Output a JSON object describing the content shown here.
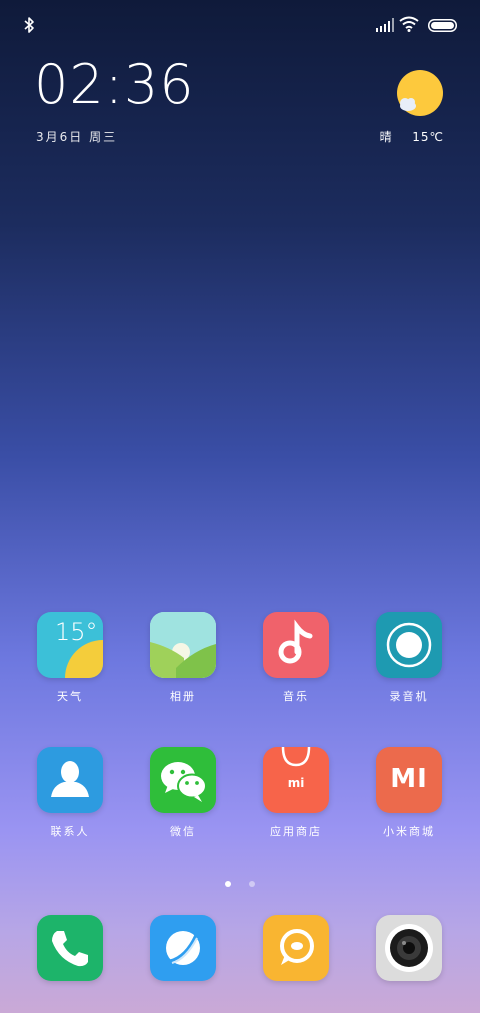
{
  "status_bar": {
    "icons": [
      "bluetooth-icon",
      "signal-icon",
      "wifi-icon",
      "battery-icon"
    ]
  },
  "clock": {
    "time": "02:36",
    "date": "3月6日 周三"
  },
  "weather": {
    "condition": "晴",
    "temperature": "15℃",
    "icon": "sun-icon"
  },
  "apps": [
    {
      "label": "天气",
      "icon_text": "15°",
      "icon": "weather-icon"
    },
    {
      "label": "相册",
      "icon": "gallery-icon"
    },
    {
      "label": "音乐",
      "icon": "music-icon"
    },
    {
      "label": "录音机",
      "icon": "recorder-icon"
    },
    {
      "label": "联系人",
      "icon": "contacts-icon"
    },
    {
      "label": "微信",
      "icon": "wechat-icon"
    },
    {
      "label": "应用商店",
      "icon_text": "mi",
      "icon": "app-store-icon"
    },
    {
      "label": "小米商城",
      "icon_text": "MI",
      "icon": "mi-store-icon"
    }
  ],
  "page_indicator": {
    "pages": 2,
    "current": 1
  },
  "dock": [
    {
      "icon": "phone-icon"
    },
    {
      "icon": "browser-icon"
    },
    {
      "icon": "messages-icon"
    },
    {
      "icon": "camera-icon"
    }
  ],
  "colors": {
    "weather": "#3cc0d8",
    "gallery": "#8bd3c8",
    "music": "#f0626b",
    "recorder": "#1e9ab1",
    "contacts": "#2d9be0",
    "wechat": "#2fbe3a",
    "app_store": "#f7644a",
    "mi_store": "#ec6a4c",
    "phone": "#1db46a",
    "browser": "#2f9ef0",
    "messages": "#f9b531",
    "camera": "#dcdcdc"
  }
}
